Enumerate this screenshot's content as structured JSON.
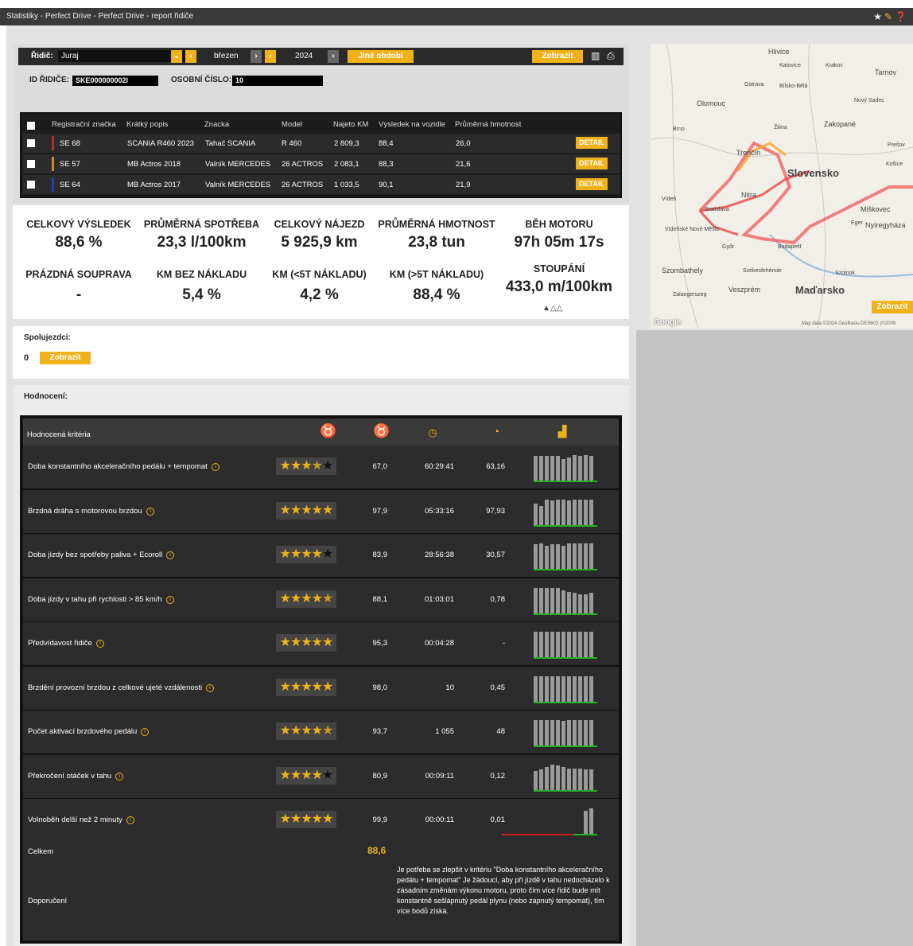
{
  "titlebar": {
    "title": "Statistiky - Perfect Drive - Perfect Drive - report řidiče",
    "icons": [
      "star-icon",
      "pin-icon",
      "help-icon"
    ]
  },
  "filters": {
    "driver_label": "Řidič:",
    "driver_value": "Juraj",
    "month": "březen",
    "year": "2024",
    "other_period": "Jiné období",
    "show": "Zobrazit",
    "driver_id_label": "ID ŘIDIČE:",
    "driver_id_value": "SKE000000002l",
    "personal_no_label": "OSOBNÍ ČÍSLO:",
    "personal_no_value": "10"
  },
  "vehicles": {
    "headers": [
      "Registrační značka",
      "Krátký popis",
      "Znacka",
      "Model",
      "Najeto KM",
      "Výsledek na vozidle",
      "Průměrná hmotnost"
    ],
    "detail_label": "DETAIL",
    "rows": [
      {
        "reg": "SE 68",
        "desc": "SCANIA R460 2023",
        "brand": "Tahač SCANIA",
        "model": "R 460",
        "km": "2 809,3",
        "result": "88,4",
        "weight": "26,0",
        "color": "#b03030"
      },
      {
        "reg": "SE 57",
        "desc": "MB Actros 2018",
        "brand": "Valník MERCEDES",
        "model": "26 ACTROS",
        "km": "2 083,1",
        "result": "88,3",
        "weight": "21,6",
        "color": "#c8901a"
      },
      {
        "reg": "SE 64",
        "desc": "MB Actros 2017",
        "brand": "Valník MERCEDES",
        "model": "26 ACTROS",
        "km": "1 033,5",
        "result": "90,1",
        "weight": "21,9",
        "color": "#2a3ab0"
      }
    ]
  },
  "summary": {
    "total_result": {
      "label": "CELKOVÝ VÝSLEDEK",
      "value": "88,6 %"
    },
    "avg_consumption": {
      "label": "PRŮMĚRNÁ SPOTŘEBA",
      "value": "23,3 l/100km"
    },
    "total_distance": {
      "label": "CELKOVÝ NÁJEZD",
      "value": "5 925,9 km"
    },
    "avg_weight": {
      "label": "PRŮMĚRNÁ HMOTNOST",
      "value": "23,8 tun"
    },
    "engine_run": {
      "label": "BĚH MOTORU",
      "value": "97h 05m 17s"
    },
    "empty_set": {
      "label": "PRÁZDNÁ SOUPRAVA",
      "value": "-"
    },
    "km_no_load": {
      "label": "KM BEZ NÁKLADU",
      "value": "5,4 %"
    },
    "km_lt5": {
      "label": "KM (<5T NÁKLADU)",
      "value": "4,2 %"
    },
    "km_gt5": {
      "label": "KM (>5T NÁKLADU)",
      "value": "88,4 %"
    },
    "climb": {
      "label": "STOUPÁNÍ",
      "value": "433,0 m/100km"
    }
  },
  "co_drivers": {
    "label": "Spolujezdci:",
    "count": "0",
    "button": "Zobrazit"
  },
  "evaluation": {
    "section_label": "Hodnocení:",
    "header_label": "Hodnocená kritéria",
    "header_icons": [
      "medal-icon",
      "medal-icon",
      "clock-icon",
      "percent-clock-icon",
      "bar-chart-icon"
    ],
    "rows": [
      {
        "name": "Doba konstantního akceleračního pedálu + tempomat",
        "stars": "★★★★★",
        "gold": 3.5,
        "score": "67,0",
        "time": "60:29:41",
        "pct": "63,16",
        "bars": [
          0.9,
          0.9,
          0.9,
          0.9,
          0.9,
          0.8,
          0.85,
          0.95,
          0.9,
          0.95,
          0.9
        ]
      },
      {
        "name": "Brzdná dráha s motorovou brzdou",
        "stars": "★★★★★",
        "gold": 5,
        "score": "97,9",
        "time": "05:33:16",
        "pct": "97,93",
        "bars": [
          0.8,
          0.7,
          0.95,
          0.9,
          0.95,
          0.95,
          0.9,
          0.95,
          0.95,
          0.95,
          0.95
        ]
      },
      {
        "name": "Doba jízdy bez spotřeby paliva + Ecoroll",
        "stars": "★★★★★",
        "gold": 4,
        "score": "83,9",
        "time": "28:56:38",
        "pct": "30,57",
        "bars": [
          0.9,
          0.95,
          0.85,
          0.9,
          0.9,
          0.85,
          0.95,
          0.95,
          0.95,
          0.95,
          0.95
        ]
      },
      {
        "name": "Doba jízdy v tahu při rychlosti > 85 km/h",
        "stars": "★★★★★",
        "gold": 4.5,
        "score": "88,1",
        "time": "01:03:01",
        "pct": "0,78",
        "bars": [
          0.95,
          0.95,
          0.95,
          0.95,
          0.95,
          0.85,
          0.8,
          0.75,
          0.7,
          0.7,
          0.75
        ]
      },
      {
        "name": "Předvídavost řidiče",
        "stars": "★★★★★",
        "gold": 5,
        "score": "95,3",
        "time": "00:04:28",
        "pct": "-",
        "bars": [
          0.95,
          0.95,
          0.95,
          0.95,
          0.95,
          0.95,
          0.95,
          0.95,
          0.95,
          0.95,
          0.95
        ]
      },
      {
        "name": "Brzdění provozní brzdou z celkové ujeté vzdálenosti",
        "stars": "★★★★★",
        "gold": 5,
        "score": "98,0",
        "time": "10",
        "pct": "0,45",
        "bars": [
          0.95,
          0.95,
          0.95,
          0.95,
          0.95,
          0.95,
          0.95,
          0.95,
          0.95,
          0.95,
          0.95
        ]
      },
      {
        "name": "Počet aktivací brzdového pedálu",
        "stars": "★★★★★",
        "gold": 4.5,
        "score": "93,7",
        "time": "1 055",
        "pct": "48",
        "bars": [
          0.95,
          0.95,
          0.95,
          0.95,
          0.95,
          0.9,
          0.95,
          0.95,
          0.95,
          0.95,
          0.95
        ]
      },
      {
        "name": "Překročení otáček v tahu",
        "stars": "★★★★★",
        "gold": 4,
        "score": "80,9",
        "time": "00:09:11",
        "pct": "0,12",
        "bars": [
          0.7,
          0.75,
          0.85,
          0.95,
          0.9,
          0.85,
          0.8,
          0.8,
          0.8,
          0.75,
          0.75
        ]
      },
      {
        "name": "Volnoběh delší než 2 minuty",
        "stars": "★★★★★",
        "gold": 5,
        "score": "99,9",
        "time": "00:00:11",
        "pct": "0,01",
        "bars": [
          0,
          0,
          0,
          0,
          0,
          0,
          0,
          0,
          0,
          0.85,
          0.95
        ]
      }
    ],
    "total_label": "Celkem",
    "total_value": "88,6",
    "recommendation_label": "Doporučení",
    "recommendation_text": "Je potřeba se zlepšit v kritériu \"Doba konstantního akceleračního pedálu + tempomat\" Je žádoucí, aby při jízdě v tahu nedocházelo k zásadním změnám výkonu motoru, proto čím více řidič bude mít konstantně sešlápnutý pedál plynu (nebo zapnutý tempomat), tím více bodů získá."
  },
  "map": {
    "labels": [
      "Hlivice",
      "Katovice",
      "Krakov",
      "Tarnov",
      "Ostrava",
      "Bílsko-Bělá",
      "Olomouc",
      "Nový Sadec",
      "Brno",
      "Zakopané",
      "Žilina",
      "Prešov",
      "Trenčín",
      "Slovensko",
      "Košice",
      "Nitra",
      "Vídeň",
      "Bratislava",
      "Miškovec",
      "Vídeňské Nové Město",
      "Eger",
      "Nyíregyháza",
      "Győr",
      "Budapešť",
      "Szombathely",
      "Székesfehérvár",
      "Szolnok",
      "Veszprém",
      "Maďarsko",
      "Zalaegerszeg"
    ],
    "button": "Zobrazit",
    "attribution": "Map data ©2024 GeoBasis-DE/BKG (©2009",
    "logo": "Google"
  }
}
